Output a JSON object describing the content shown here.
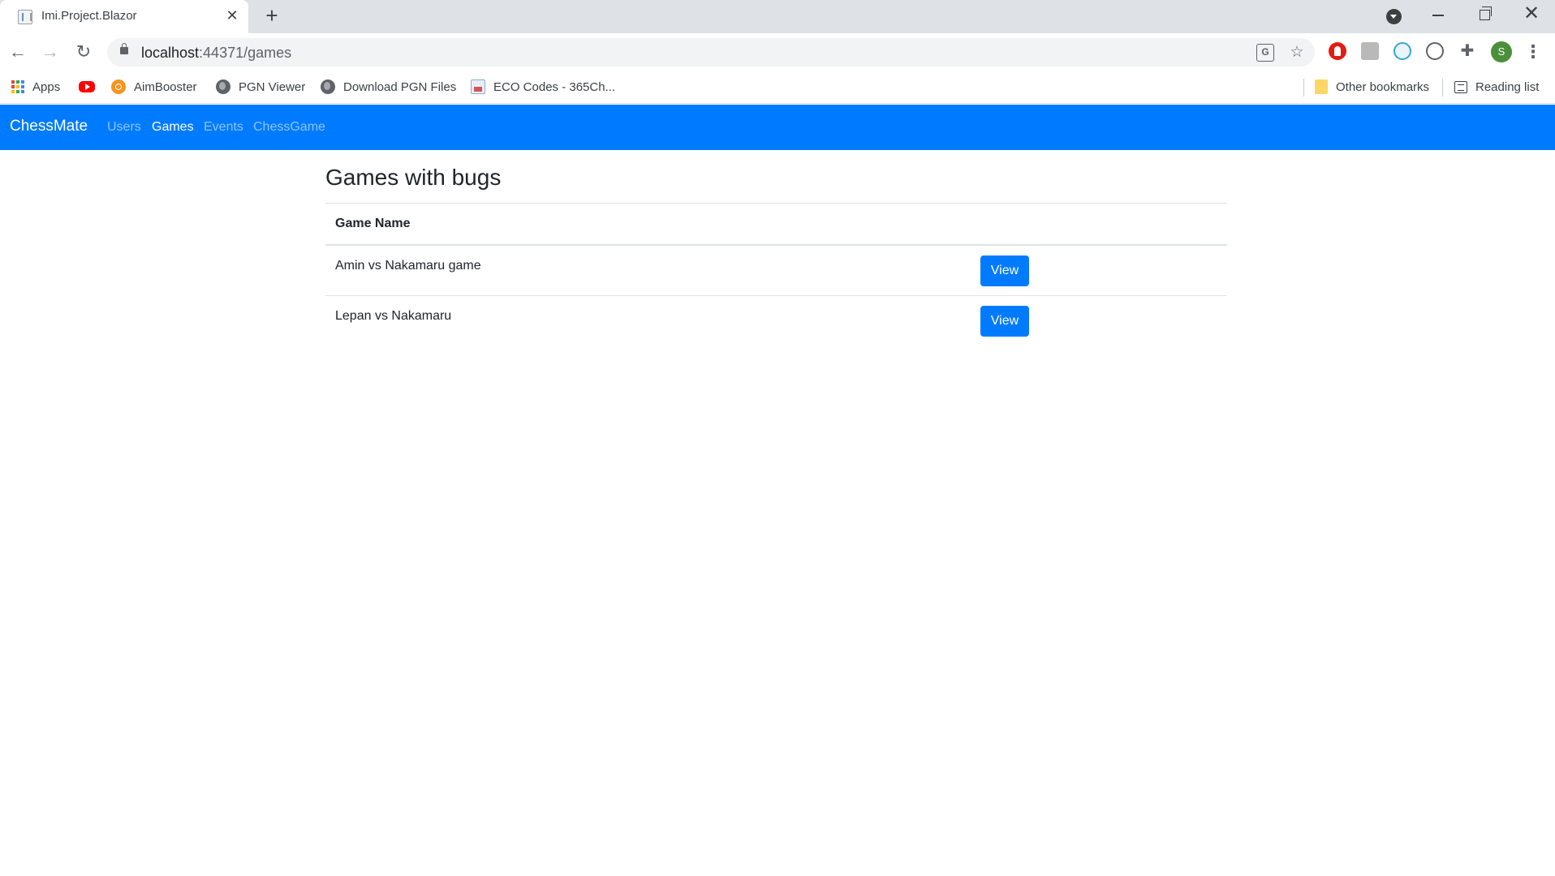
{
  "browser": {
    "tab_title": "Imi.Project.Blazor",
    "tab_close_icon": "✕",
    "new_tab_icon": "+",
    "url_host": "localhost",
    "url_path": ":44371/games",
    "back_icon": "←",
    "forward_icon": "→",
    "reload_icon": "↻",
    "star_icon": "☆",
    "translate_icon": "G",
    "puzzle_icon": "✚",
    "avatar_letter": "S",
    "menu_icon": "⋮",
    "win_close_icon": "✕"
  },
  "bookmarks": {
    "items": [
      {
        "label": "Apps",
        "icon": "apps-grid-icon"
      },
      {
        "label": "",
        "icon": "youtube-icon"
      },
      {
        "label": "AimBooster",
        "icon": "aimbooster-icon"
      },
      {
        "label": "PGN Viewer",
        "icon": "globe-icon"
      },
      {
        "label": "Download PGN Files",
        "icon": "globe-icon"
      },
      {
        "label": "ECO Codes - 365Ch...",
        "icon": "eco-icon"
      }
    ],
    "other_bookmarks": "Other bookmarks",
    "reading_list": "Reading list"
  },
  "app": {
    "brand": "ChessMate",
    "nav": [
      {
        "label": "Users",
        "active": false
      },
      {
        "label": "Games",
        "active": true
      },
      {
        "label": "Events",
        "active": false
      },
      {
        "label": "ChessGame",
        "active": false
      }
    ]
  },
  "main": {
    "title": "Games with bugs",
    "table": {
      "header": "Game Name",
      "rows": [
        {
          "name": "Amin vs Nakamaru game",
          "action": "View"
        },
        {
          "name": "Lepan vs Nakamaru",
          "action": "View"
        }
      ]
    }
  },
  "colors": {
    "primary": "#007bff",
    "navbar": "#007bff",
    "tabstrip": "#dee1e6"
  }
}
